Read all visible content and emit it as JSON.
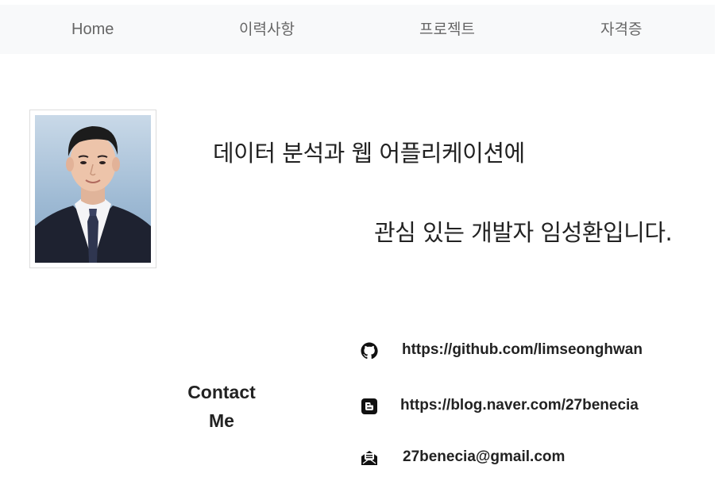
{
  "nav": {
    "items": [
      {
        "label": "Home"
      },
      {
        "label": "이력사항"
      },
      {
        "label": "프로젝트"
      },
      {
        "label": "자격증"
      }
    ]
  },
  "profile": {
    "photo_alt": "profile-photo"
  },
  "intro": {
    "line1": "데이터 분석과 웹 어플리케이션에",
    "line2": "관심 있는 개발자 임성환입니다."
  },
  "contact": {
    "title_line1": "Contact",
    "title_line2": "Me",
    "items": [
      {
        "icon": "github-icon",
        "text": "https://github.com/limseonghwan"
      },
      {
        "icon": "blog-icon",
        "text": "https://blog.naver.com/27benecia"
      },
      {
        "icon": "email-icon",
        "text": "27benecia@gmail.com"
      }
    ]
  },
  "colors": {
    "nav_background": "#f8f9fa",
    "nav_text": "#666666",
    "body_text": "#222222",
    "photo_background": "#a9c2d9"
  }
}
